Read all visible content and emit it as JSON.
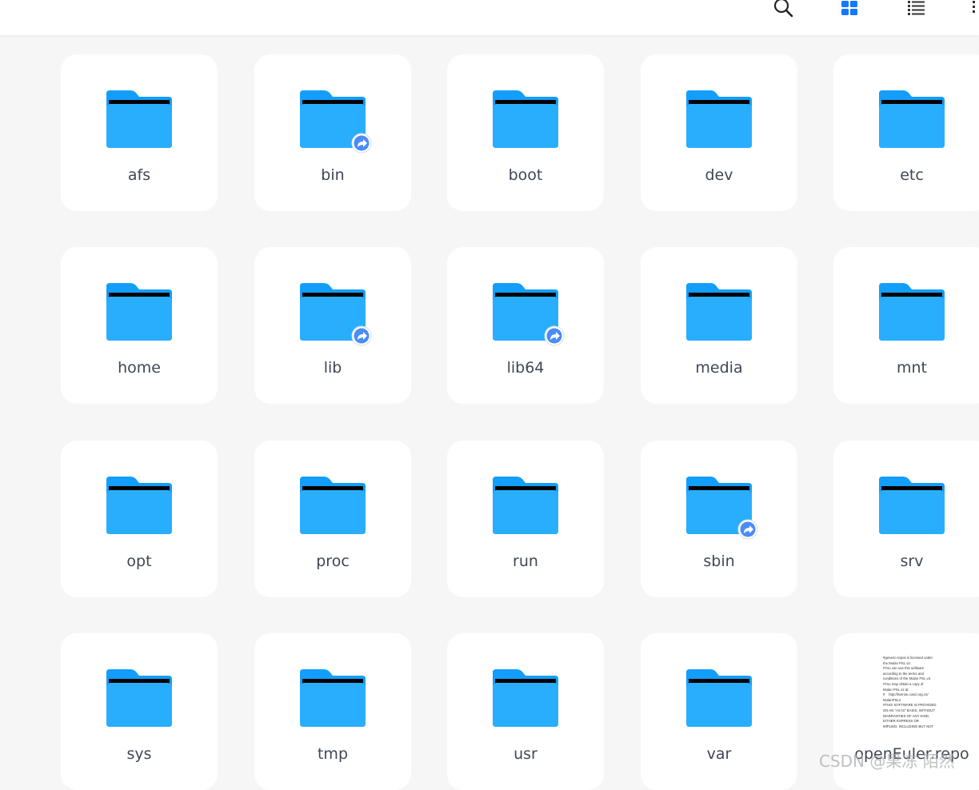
{
  "toolbar": {
    "search_icon": "search-icon",
    "grid_view_icon": "grid-view-icon",
    "list_view_icon": "list-view-icon",
    "more_icon": "more-icon",
    "active_view_color": "#1677ff"
  },
  "colors": {
    "folder": "#29aefe",
    "folder_tab": "#139efc",
    "share_badge": "#4b8cf6"
  },
  "items": [
    {
      "name": "afs",
      "type": "folder",
      "link": false
    },
    {
      "name": "bin",
      "type": "folder",
      "link": true
    },
    {
      "name": "boot",
      "type": "folder",
      "link": false
    },
    {
      "name": "dev",
      "type": "folder",
      "link": false
    },
    {
      "name": "etc",
      "type": "folder",
      "link": false
    },
    {
      "name": "home",
      "type": "folder",
      "link": false
    },
    {
      "name": "lib",
      "type": "folder",
      "link": true
    },
    {
      "name": "lib64",
      "type": "folder",
      "link": true
    },
    {
      "name": "media",
      "type": "folder",
      "link": false
    },
    {
      "name": "mnt",
      "type": "folder",
      "link": false
    },
    {
      "name": "opt",
      "type": "folder",
      "link": false
    },
    {
      "name": "proc",
      "type": "folder",
      "link": false
    },
    {
      "name": "run",
      "type": "folder",
      "link": false
    },
    {
      "name": "sbin",
      "type": "folder",
      "link": true
    },
    {
      "name": "srv",
      "type": "folder",
      "link": false
    },
    {
      "name": "sys",
      "type": "folder",
      "link": false
    },
    {
      "name": "tmp",
      "type": "folder",
      "link": false
    },
    {
      "name": "usr",
      "type": "folder",
      "link": false
    },
    {
      "name": "var",
      "type": "folder",
      "link": false
    },
    {
      "name": "openEuler.repo",
      "type": "file",
      "link": false,
      "preview": "#generic-repos is licensed under\nthe Mulan PSL v2.\n#You can use this software\naccording to the terms and\nconditions of the Mulan PSL v2.\n#You may obtain a copy of\nMulan PSL v2 at:\n#    http://license.coscl.org.cn/\nMulanPSL2\n#THIS SOFTWARE IS PROVIDED\nON AN \"AS IS\" BASIS, WITHOUT\nWARRANTIES OF ANY KIND,\nEITHER EXPRESS OR\nIMPLIED, INCLUDING BUT NOT"
    }
  ],
  "watermark": "CSDN @果冻 陌然"
}
